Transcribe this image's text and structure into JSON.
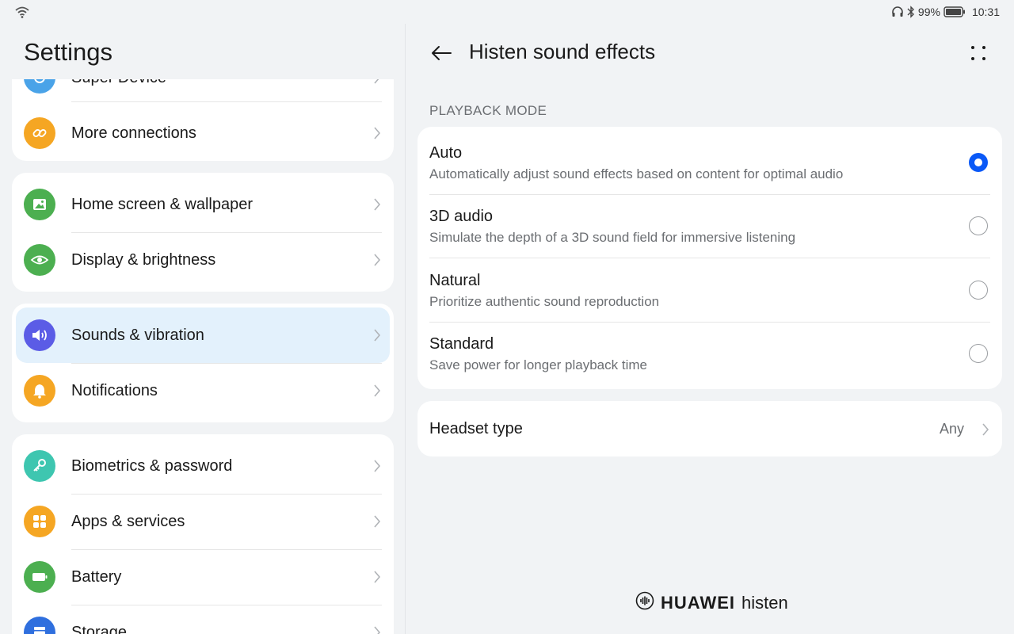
{
  "status_bar": {
    "battery_percent": "99%",
    "time": "10:31"
  },
  "left_panel": {
    "title": "Settings",
    "groups": [
      {
        "items": [
          {
            "label": "Super Device",
            "icon": "super-device-icon",
            "color": "#4aa3e8"
          },
          {
            "label": "More connections",
            "icon": "link-icon",
            "color": "#f5a623"
          }
        ]
      },
      {
        "items": [
          {
            "label": "Home screen & wallpaper",
            "icon": "image-icon",
            "color": "#4caf50"
          },
          {
            "label": "Display & brightness",
            "icon": "eye-icon",
            "color": "#4caf50"
          }
        ]
      },
      {
        "items": [
          {
            "label": "Sounds & vibration",
            "icon": "speaker-icon",
            "color": "#5b5ce6",
            "selected": true
          },
          {
            "label": "Notifications",
            "icon": "bell-icon",
            "color": "#f5a623"
          }
        ]
      },
      {
        "items": [
          {
            "label": "Biometrics & password",
            "icon": "key-icon",
            "color": "#3ec6b0"
          },
          {
            "label": "Apps & services",
            "icon": "apps-icon",
            "color": "#f5a623"
          },
          {
            "label": "Battery",
            "icon": "battery-icon",
            "color": "#4caf50"
          },
          {
            "label": "Storage",
            "icon": "storage-icon",
            "color": "#2f6fde"
          }
        ]
      }
    ]
  },
  "right_panel": {
    "title": "Histen sound effects",
    "section_header": "PLAYBACK MODE",
    "options": [
      {
        "title": "Auto",
        "desc": "Automatically adjust sound effects based on content for optimal audio",
        "selected": true
      },
      {
        "title": "3D audio",
        "desc": "Simulate the depth of a 3D sound field for immersive listening",
        "selected": false
      },
      {
        "title": "Natural",
        "desc": "Prioritize authentic sound reproduction",
        "selected": false
      },
      {
        "title": "Standard",
        "desc": "Save power for longer playback time",
        "selected": false
      }
    ],
    "headset": {
      "label": "Headset type",
      "value": "Any"
    },
    "brand": {
      "part1": "HUAWEI",
      "part2": "histen"
    },
    "accent_color": "#0a59f7"
  }
}
